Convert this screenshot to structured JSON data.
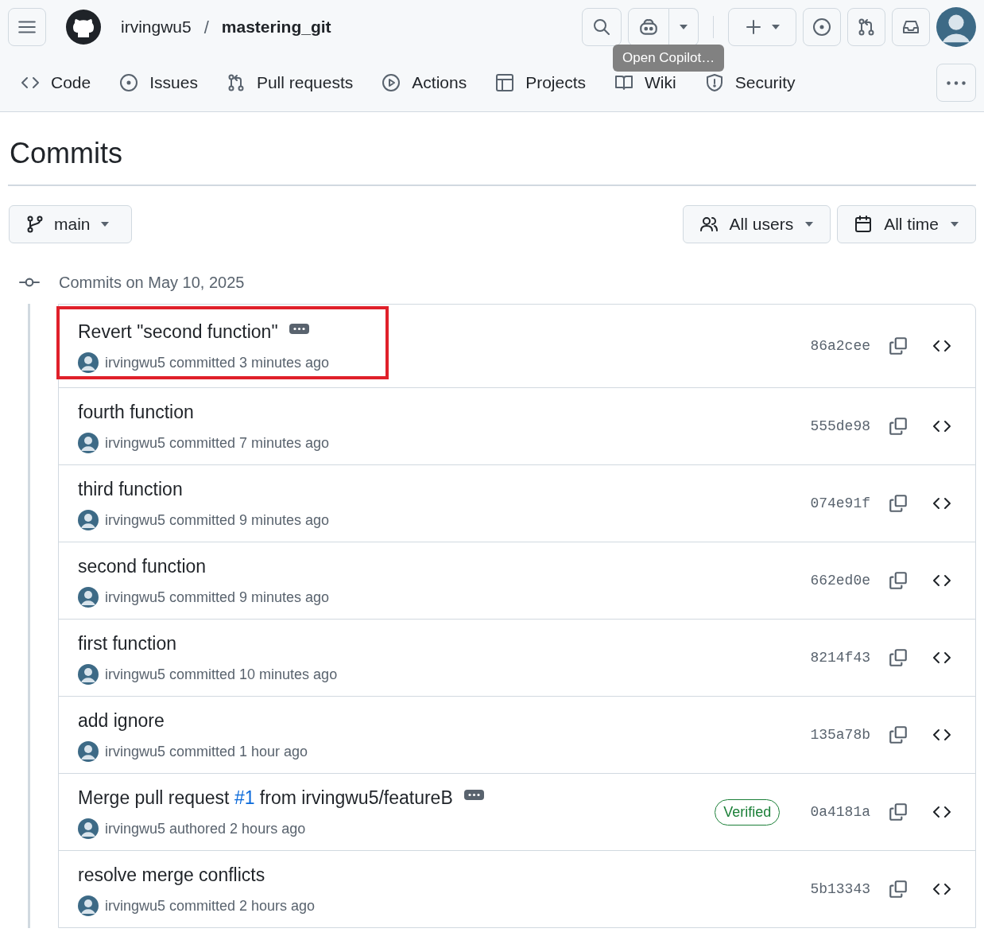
{
  "header": {
    "owner": "irvingwu5",
    "separator": "/",
    "repo": "mastering_git"
  },
  "tooltip": {
    "text": "Open Copilot…"
  },
  "tabs": [
    {
      "label": "Code",
      "selected": false
    },
    {
      "label": "Issues",
      "selected": false
    },
    {
      "label": "Pull requests",
      "selected": false
    },
    {
      "label": "Actions",
      "selected": false
    },
    {
      "label": "Projects",
      "selected": false
    },
    {
      "label": "Wiki",
      "selected": false
    },
    {
      "label": "Security",
      "selected": false
    }
  ],
  "page_title": "Commits",
  "branch": {
    "label": "main"
  },
  "filters": [
    {
      "label": "All users"
    },
    {
      "label": "All time"
    }
  ],
  "group": {
    "heading": "Commits on May 10, 2025"
  },
  "commits": [
    {
      "title": "Revert \"second function\"",
      "has_ellipsis": true,
      "highlighted": true,
      "author": "irvingwu5",
      "action": "committed",
      "time": "3 minutes ago",
      "sha": "86a2cee"
    },
    {
      "title": "fourth function",
      "has_ellipsis": false,
      "highlighted": false,
      "author": "irvingwu5",
      "action": "committed",
      "time": "7 minutes ago",
      "sha": "555de98"
    },
    {
      "title": "third function",
      "has_ellipsis": false,
      "highlighted": false,
      "author": "irvingwu5",
      "action": "committed",
      "time": "9 minutes ago",
      "sha": "074e91f"
    },
    {
      "title": "second function",
      "has_ellipsis": false,
      "highlighted": false,
      "author": "irvingwu5",
      "action": "committed",
      "time": "9 minutes ago",
      "sha": "662ed0e"
    },
    {
      "title": "first function",
      "has_ellipsis": false,
      "highlighted": false,
      "author": "irvingwu5",
      "action": "committed",
      "time": "10 minutes ago",
      "sha": "8214f43"
    },
    {
      "title": "add ignore",
      "has_ellipsis": false,
      "highlighted": false,
      "author": "irvingwu5",
      "action": "committed",
      "time": "1 hour ago",
      "sha": "135a78b"
    },
    {
      "title_parts": [
        {
          "kind": "text",
          "text": "Merge pull request "
        },
        {
          "kind": "link",
          "text": "#1"
        },
        {
          "kind": "text",
          "text": " from irvingwu5/featureB"
        }
      ],
      "has_ellipsis": true,
      "highlighted": false,
      "badge": "Verified",
      "author": "irvingwu5",
      "action": "authored",
      "time": "2 hours ago",
      "sha": "0a4181a"
    },
    {
      "title": "resolve merge conflicts",
      "has_ellipsis": false,
      "highlighted": false,
      "author": "irvingwu5",
      "action": "committed",
      "time": "2 hours ago",
      "sha": "5b13343"
    }
  ]
}
